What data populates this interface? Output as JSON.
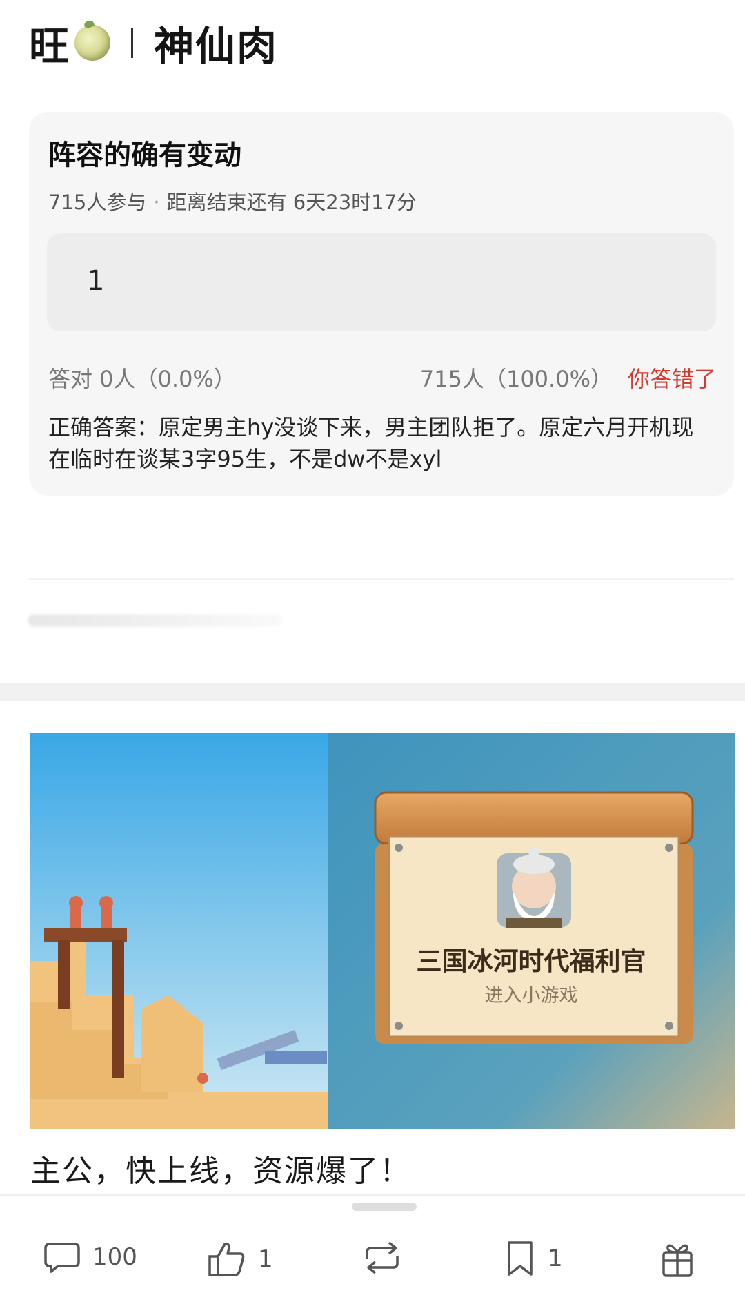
{
  "header": {
    "name_left": "旺",
    "name_right": "神仙肉"
  },
  "quiz": {
    "title": "阵容的确有变动",
    "participants": "715人参与",
    "deadline": "距离结束还有 6天23时17分",
    "user_answer": "1",
    "correct_stats": "答对  0人（0.0%）",
    "wrong_stats": "715人（100.0%）",
    "verdict": "你答错了",
    "correct_answer": "正确答案：原定男主hy没谈下来，男主团队拒了。原定六月开机现在临时在谈某3字95生，不是dw不是xyl"
  },
  "ad": {
    "sign_title": "三国冰河时代福利官",
    "sign_subtitle": "进入小游戏",
    "caption": "主公，快上线，资源爆了！"
  },
  "actions": {
    "comment_count": "100",
    "like_count": "1",
    "bookmark_count": "1"
  },
  "icons": [
    "melon-icon",
    "comment-icon",
    "thumbs-up-icon",
    "repost-icon",
    "bookmark-icon",
    "gift-icon"
  ],
  "colors": {
    "wrong_red": "#d23b2f",
    "card_bg": "#f6f6f6"
  }
}
